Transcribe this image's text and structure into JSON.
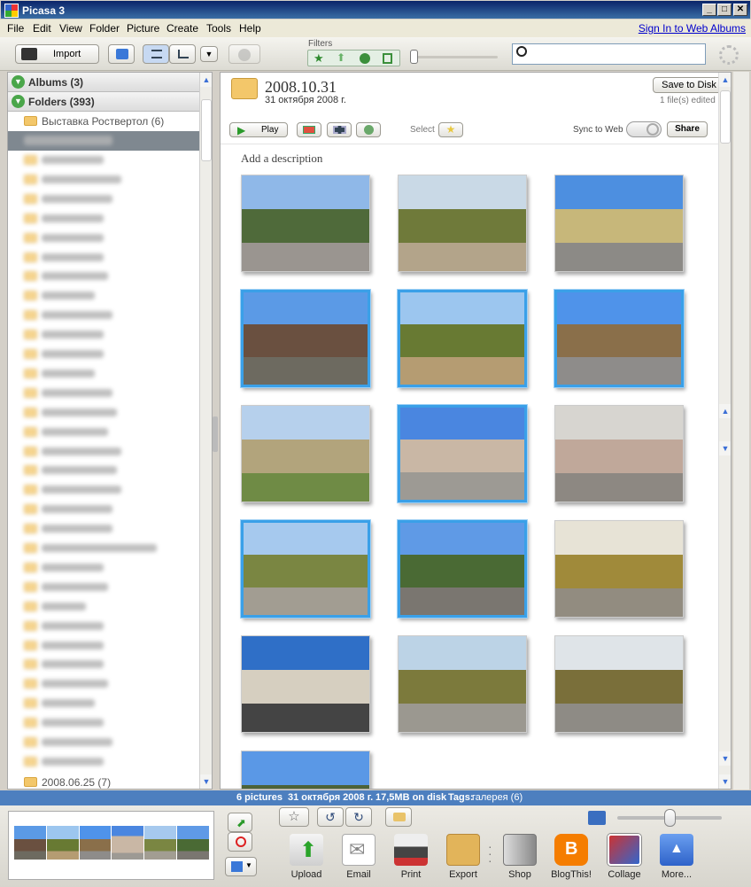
{
  "window": {
    "title": "Picasa 3",
    "controls": [
      "_",
      "□",
      "✕"
    ]
  },
  "menu": {
    "items": [
      "File",
      "Edit",
      "View",
      "Folder",
      "Picture",
      "Create",
      "Tools",
      "Help"
    ],
    "sign_in": "Sign In to Web Albums"
  },
  "toolbar": {
    "import_label": "Import",
    "filters_label": "Filters",
    "search_placeholder": ""
  },
  "library": {
    "albums_label": "Albums (3)",
    "folders_label": "Folders (393)",
    "folder_top": "Выставка Роствертол (6)",
    "folder_bottom": "2008.06.25 (7)"
  },
  "folder": {
    "title": "2008.10.31",
    "date": "31 октября 2008 г.",
    "save_label": "Save to Disk",
    "edited_note": "1 file(s) edited",
    "play_label": "Play",
    "select_label": "Select",
    "sync_label": "Sync to Web",
    "share_label": "Share",
    "description_placeholder": "Add a description"
  },
  "photos": [
    {
      "name": "Street with trees",
      "selected": false,
      "sky": "#8fb8e8",
      "mid": "#4f6a3a",
      "ground": "#9a9590"
    },
    {
      "name": "Tree-lined sidewalk",
      "selected": false,
      "sky": "#c9d9e6",
      "mid": "#6f7a3a",
      "ground": "#b3a48a"
    },
    {
      "name": "School building",
      "selected": false,
      "sky": "#4d8fe0",
      "mid": "#c7b77a",
      "ground": "#8c8a86"
    },
    {
      "name": "Radio tower",
      "selected": true,
      "sky": "#5b9ae6",
      "mid": "#6a5040",
      "ground": "#6d6a60"
    },
    {
      "name": "Park path",
      "selected": true,
      "sky": "#9cc6ef",
      "mid": "#687a33",
      "ground": "#b59c72"
    },
    {
      "name": "Street corner",
      "selected": true,
      "sky": "#4f93ea",
      "mid": "#8a6f4a",
      "ground": "#8e8c8a"
    },
    {
      "name": "Old building",
      "selected": false,
      "sky": "#b6d0ec",
      "mid": "#b2a47c",
      "ground": "#6f8b45"
    },
    {
      "name": "High-rise",
      "selected": true,
      "sky": "#4a86e0",
      "mid": "#c9b7a5",
      "ground": "#9d9a94"
    },
    {
      "name": "Apartment block",
      "selected": false,
      "sky": "#d7d5d0",
      "mid": "#c0a89a",
      "ground": "#8d8882"
    },
    {
      "name": "Avenue",
      "selected": true,
      "sky": "#a6c9ee",
      "mid": "#7a8642",
      "ground": "#a29d92"
    },
    {
      "name": "Tram tracks",
      "selected": true,
      "sky": "#5f9ae6",
      "mid": "#4a6a34",
      "ground": "#7a7670"
    },
    {
      "name": "Autumn trees",
      "selected": false,
      "sky": "#e7e3d6",
      "mid": "#a08a3a",
      "ground": "#928c80"
    },
    {
      "name": "Hospital",
      "selected": false,
      "sky": "#2f6fc7",
      "mid": "#d6cfc0",
      "ground": "#444"
    },
    {
      "name": "Park fence",
      "selected": false,
      "sky": "#bcd3e6",
      "mid": "#7c7a3c",
      "ground": "#9b9890"
    },
    {
      "name": "Boulevard",
      "selected": false,
      "sky": "#dfe4e8",
      "mid": "#7a6f3a",
      "ground": "#8e8b85"
    },
    {
      "name": "Trees and sky",
      "selected": false,
      "sky": "#5a98e6",
      "mid": "#4c6238",
      "ground": "#6b6a5e"
    }
  ],
  "status": {
    "pictures": "6 pictures",
    "date": "31 октября 2008 г.",
    "size": "17,5MB on disk",
    "tags_label": "Tags:",
    "tags_value": "галерея (6)"
  },
  "actions": [
    "Upload",
    "Email",
    "Print",
    "Export",
    "Shop",
    "BlogThis!",
    "Collage",
    "More..."
  ]
}
